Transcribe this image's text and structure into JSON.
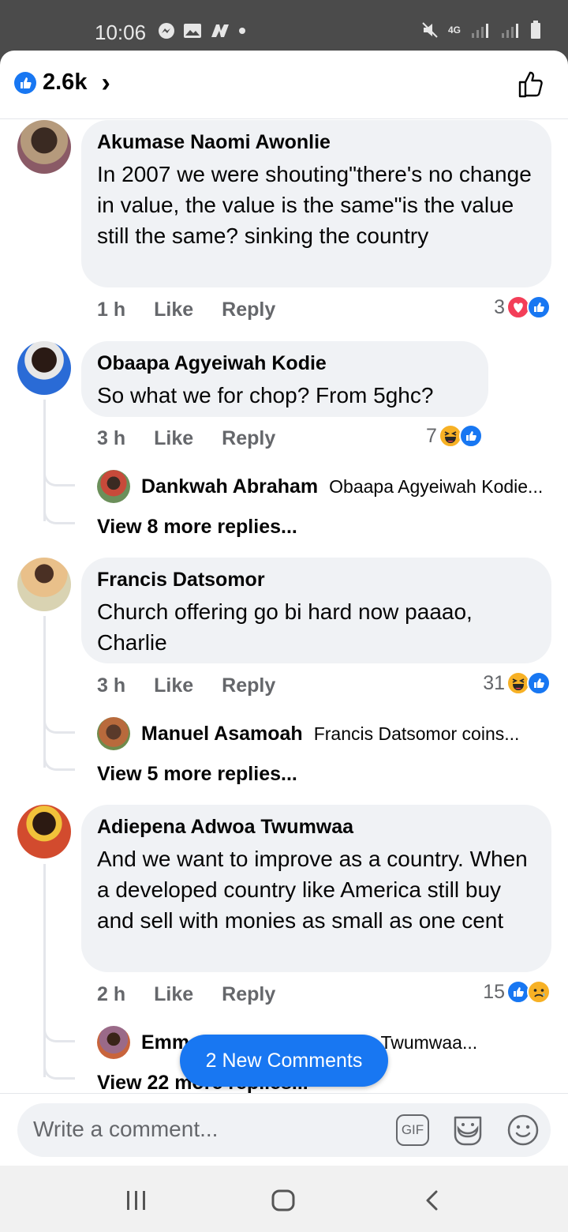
{
  "status_bar": {
    "time": "10:06",
    "network": "4G"
  },
  "header": {
    "likes_count": "2.6k"
  },
  "comments": [
    {
      "author": "Akumase Naomi Awonlie",
      "text": "In 2007 we were shouting\"there's no change in value, the value is the same\"is the value still the same? sinking the country",
      "time": "1 h",
      "like": "Like",
      "reply": "Reply",
      "reactions_count": "3",
      "reactions": [
        "love-icon",
        "like-icon"
      ]
    },
    {
      "author": "Obaapa Agyeiwah Kodie",
      "text": "So what we for chop? From 5ghc?",
      "time": "3 h",
      "like": "Like",
      "reply": "Reply",
      "reactions_count": "7",
      "reactions": [
        "haha-icon",
        "like-icon"
      ],
      "reply_preview": {
        "author": "Dankwah Abraham",
        "snippet": "Obaapa Agyeiwah Kodie..."
      },
      "view_more": "View 8 more replies..."
    },
    {
      "author": "Francis Datsomor",
      "text": "Church offering go bi hard now paaao, Charlie",
      "time": "3 h",
      "like": "Like",
      "reply": "Reply",
      "reactions_count": "31",
      "reactions": [
        "haha-icon",
        "like-icon"
      ],
      "reply_preview": {
        "author": "Manuel Asamoah",
        "snippet": "Francis Datsomor coins..."
      },
      "view_more": "View 5 more replies..."
    },
    {
      "author": "Adiepena Adwoa Twumwaa",
      "text": "And we want to improve as a country. When a developed country like America still buy and sell with monies as small as one cent",
      "time": "2 h",
      "like": "Like",
      "reply": "Reply",
      "reactions_count": "15",
      "reactions": [
        "like-icon",
        "sad-icon"
      ],
      "reply_preview": {
        "author": "Emm",
        "snippet": "Adwoa Twumwaa..."
      },
      "view_more": "View 22 more replies..."
    }
  ],
  "new_comments_pill": "2 New Comments",
  "composer": {
    "placeholder": "Write a comment...",
    "gif_label": "GIF"
  },
  "colors": {
    "accent": "#1877f2",
    "love": "#f33e58",
    "haha": "#f7b125"
  }
}
